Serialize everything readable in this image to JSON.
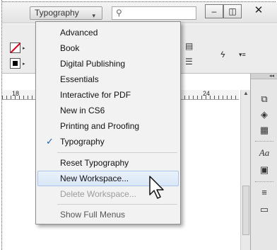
{
  "titlebar": {
    "workspace_button": "Typography",
    "workspace_caret": "▾",
    "search_placeholder": "",
    "search_icon": "⚲",
    "minimize": "–",
    "restore": "◫",
    "close": "✕"
  },
  "ruler": {
    "labels": [
      "18",
      "24"
    ]
  },
  "menu": {
    "items": [
      {
        "label": "Advanced"
      },
      {
        "label": "Book"
      },
      {
        "label": "Digital Publishing"
      },
      {
        "label": "Essentials"
      },
      {
        "label": "Interactive for PDF"
      },
      {
        "label": "New in CS6"
      },
      {
        "label": "Printing and Proofing"
      },
      {
        "label": "Typography",
        "checked": true,
        "check_glyph": "✓"
      }
    ],
    "actions": [
      {
        "label": "Reset Typography"
      },
      {
        "label": "New Workspace..."
      },
      {
        "label": "Delete Workspace..."
      }
    ],
    "footer": {
      "label": "Show Full Menus"
    }
  },
  "dock": {
    "collapse_glyph": "◂◂",
    "icons": [
      "pages-icon",
      "layers-icon",
      "swatches-icon",
      "character-styles-icon",
      "paragraph-icon",
      "stroke-icon",
      "gradient-icon"
    ]
  },
  "colors": {
    "menu_bg": "#f2f2f2",
    "hover_border": "#a8c6ec",
    "disabled_text": "#9b9b9b",
    "check": "#1a5fb4"
  }
}
